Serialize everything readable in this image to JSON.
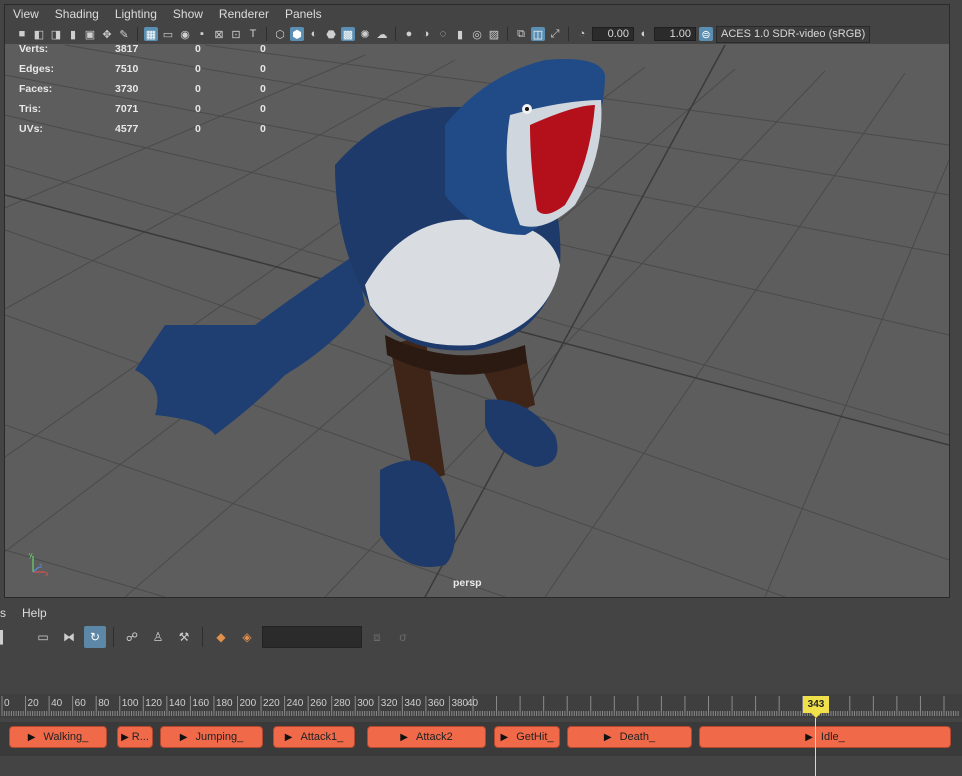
{
  "menu": [
    "View",
    "Shading",
    "Lighting",
    "Show",
    "Renderer",
    "Panels"
  ],
  "toolbar": {
    "exposure_value": "0.00",
    "gamma_value": "1.00",
    "color_space": "ACES 1.0 SDR-video (sRGB)"
  },
  "stats": [
    {
      "label": "Verts:",
      "v1": "3817",
      "v2": "0",
      "v3": "0"
    },
    {
      "label": "Edges:",
      "v1": "7510",
      "v2": "0",
      "v3": "0"
    },
    {
      "label": "Faces:",
      "v1": "3730",
      "v2": "0",
      "v3": "0"
    },
    {
      "label": "Tris:",
      "v1": "7071",
      "v2": "0",
      "v3": "0"
    },
    {
      "label": "UVs:",
      "v1": "4577",
      "v2": "0",
      "v3": "0"
    }
  ],
  "camera_label": "persp",
  "axis": {
    "x": "x",
    "y": "y",
    "z": "z"
  },
  "lower_menu": {
    "partial": "s",
    "help": "Help"
  },
  "timeline": {
    "ticks": [
      "0",
      "20",
      "40",
      "60",
      "80",
      "100",
      "120",
      "140",
      "160",
      "180",
      "200",
      "220",
      "240",
      "260",
      "280",
      "300",
      "320",
      "340",
      "360",
      "380",
      "40"
    ],
    "current_frame": "343"
  },
  "clips": [
    {
      "label": "Walking_"
    },
    {
      "label": "R..."
    },
    {
      "label": "Jumping_"
    },
    {
      "label": "Attack1_"
    },
    {
      "label": "Attack2"
    },
    {
      "label": "GetHit_"
    },
    {
      "label": "Death_"
    },
    {
      "label": "Idle_"
    }
  ],
  "colors": {
    "clip_fill": "#f06a4a",
    "playhead": "#f0e14b",
    "active_tool": "#5a8fb3",
    "viewport_bg": "#5d5d5d"
  }
}
